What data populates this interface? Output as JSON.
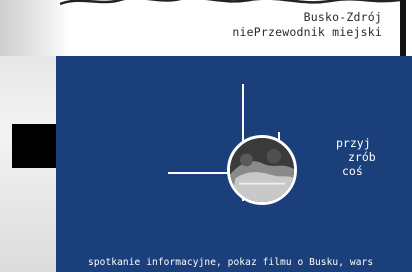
{
  "header": {
    "title_line_1": "Busko-Zdrój",
    "title_line_2": "niePrzewodnik miejski"
  },
  "hero": {
    "tagline": [
      "przyj",
      "zrób",
      "coś"
    ],
    "thumbnail": "circular-photo-thumbnail"
  },
  "footer": {
    "description": "spotkanie informacyjne, pokaz filmu o Busku, wars"
  },
  "colors": {
    "panel": "#1b3f7b",
    "accent_lines": "#ffffff",
    "text_dark": "#2b2b2b"
  }
}
